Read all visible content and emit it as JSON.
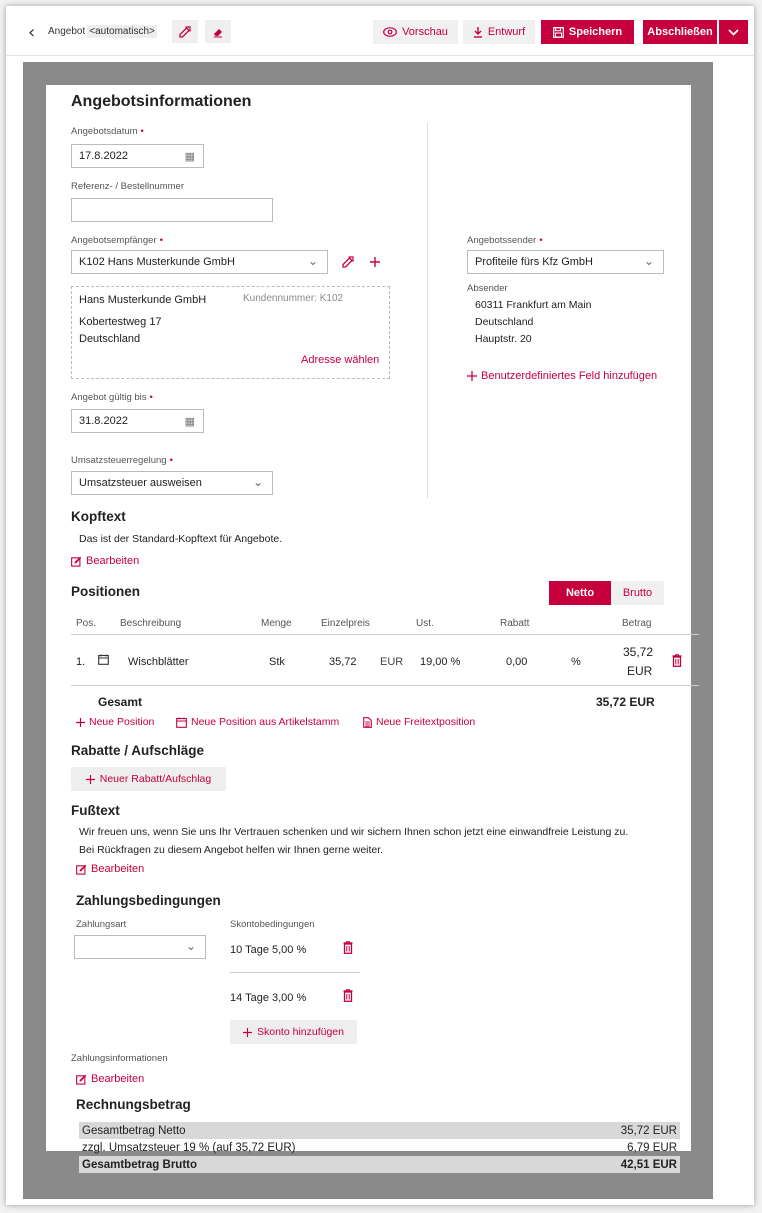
{
  "header": {
    "title_prefix": "Angebot",
    "title_auto": "<automatisch>",
    "preview_label": "Vorschau",
    "draft_label": "Entwurf",
    "save_label": "Speichern",
    "finish_label": "Abschließen"
  },
  "info": {
    "heading": "Angebotsinformationen",
    "date_label": "Angebotsdatum",
    "date_value": "17.8.2022",
    "ref_label": "Referenz- / Bestellnummer",
    "ref_value": "",
    "recipient_label": "Angebotsempfänger",
    "recipient_value": "K102 Hans Musterkunde GmbH",
    "address": {
      "name": "Hans Musterkunde GmbH",
      "customer_no": "Kundennummer: K102",
      "street": "Kobertestweg 17",
      "country": "Deutschland",
      "choose_label": "Adresse wählen"
    },
    "valid_label": "Angebot gültig bis",
    "valid_value": "31.8.2022",
    "tax_label": "Umsatzsteuerregelung",
    "tax_value": "Umsatzsteuer ausweisen",
    "sender_label": "Angebotssender",
    "sender_value": "Profiteile fürs Kfz GmbH",
    "absender_label": "Absender",
    "absender_lines": [
      "60311 Frankfurt am Main",
      "Deutschland",
      "Hauptstr. 20"
    ],
    "custom_field_label": "Benutzerdefiniertes Feld hinzufügen"
  },
  "kopftext": {
    "heading": "Kopftext",
    "text": "Das ist der Standard-Kopftext für Angebote.",
    "edit_label": "Bearbeiten"
  },
  "positions": {
    "heading": "Positionen",
    "toggle_net": "Netto",
    "toggle_gross": "Brutto",
    "columns": {
      "pos": "Pos.",
      "desc": "Beschreibung",
      "qty": "Menge",
      "unit_price": "Einzelpreis",
      "vat": "Ust.",
      "discount": "Rabatt",
      "amount": "Betrag"
    },
    "rows": [
      {
        "pos": "1.",
        "desc": "Wischblätter",
        "qty": "Stk",
        "unit_price": "35,72",
        "currency": "EUR",
        "vat": "19,00 %",
        "discount": "0,00",
        "discount_unit": "%",
        "amount": "35,72",
        "amount_currency": "EUR"
      }
    ],
    "total_label": "Gesamt",
    "total_value": "35,72 EUR",
    "new_position": "Neue Position",
    "new_from_articles": "Neue Position aus Artikelstamm",
    "new_freetext": "Neue Freitextposition"
  },
  "discounts": {
    "heading": "Rabatte / Aufschläge",
    "add_label": "Neuer Rabatt/Aufschlag"
  },
  "fusstext": {
    "heading": "Fußtext",
    "line1": "Wir freuen uns, wenn Sie uns Ihr Vertrauen schenken und wir sichern Ihnen schon jetzt eine einwandfreie Leistung zu.",
    "line2": "Bei Rückfragen zu diesem Angebot helfen wir Ihnen gerne weiter.",
    "edit_label": "Bearbeiten"
  },
  "payment": {
    "heading": "Zahlungsbedingungen",
    "type_label": "Zahlungsart",
    "type_value": "",
    "skonto_label": "Skontobedingungen",
    "skonto": [
      "10 Tage 5,00 %",
      "14 Tage 3,00 %"
    ],
    "add_skonto_label": "Skonto hinzufügen",
    "info_label": "Zahlungsinformationen",
    "edit_label": "Bearbeiten"
  },
  "invoice": {
    "heading": "Rechnungsbetrag",
    "rows": [
      {
        "label": "Gesamtbetrag Netto",
        "value": "35,72 EUR"
      },
      {
        "label": "zzgl. Umsatzsteuer 19 % (auf 35,72 EUR)",
        "value": "6,79 EUR"
      },
      {
        "label": "Gesamtbetrag Brutto",
        "value": "42,51 EUR"
      }
    ]
  },
  "colors": {
    "accent": "#c6003c",
    "background_gray": "#8a8a8a"
  }
}
